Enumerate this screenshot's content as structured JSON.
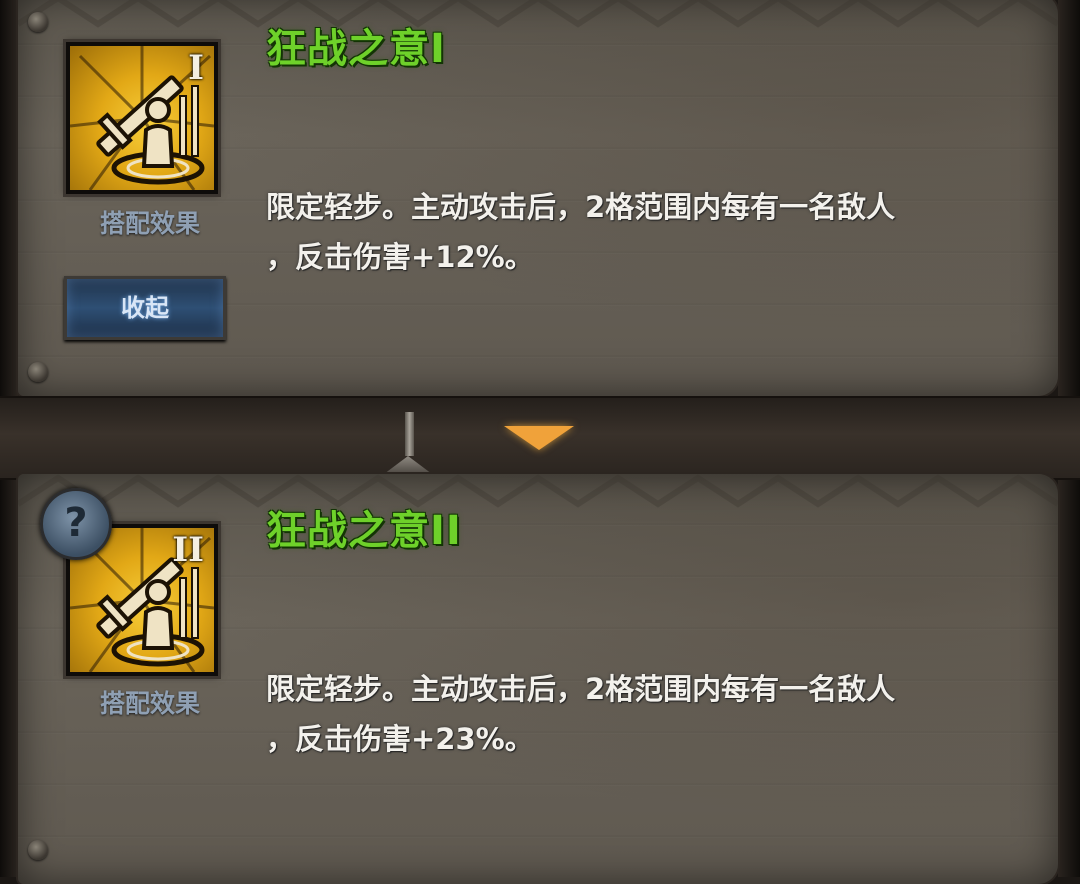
{
  "skills": [
    {
      "title": "狂战之意",
      "level": "I",
      "combo_label": "搭配效果",
      "description_line1": "限定轻步。主动攻击后，2格范围内每有一名敌人",
      "description_line2": "，反击伤害+12%。"
    },
    {
      "title": "狂战之意",
      "level": "II",
      "combo_label": "搭配效果",
      "description_line1": "限定轻步。主动攻击后，2格范围内每有一名敌人",
      "description_line2": "，反击伤害+23%。"
    }
  ],
  "collapse_button_label": "收起",
  "help_icon_glyph": "?",
  "colors": {
    "title_green": "#6ed12a",
    "icon_gold": "#e2a816",
    "button_blue": "#2e4f74",
    "divider_arrow": "#f0a23a"
  },
  "icons": {
    "skill_icon": "sword-person-icon",
    "help": "question-icon",
    "expand_indicator": "triangle-down-icon"
  }
}
